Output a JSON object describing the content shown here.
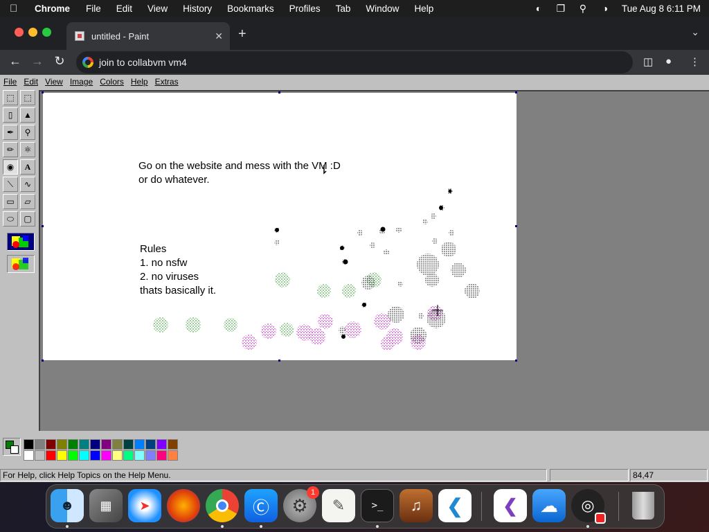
{
  "menubar": {
    "app": "Chrome",
    "items": [
      "File",
      "Edit",
      "View",
      "History",
      "Bookmarks",
      "Profiles",
      "Tab",
      "Window",
      "Help"
    ],
    "clock": "Tue Aug 8  6:11 PM"
  },
  "browser": {
    "tab_title": "untitled - Paint",
    "address": "join to collabvm vm4"
  },
  "paint": {
    "menu": [
      "File",
      "Edit",
      "View",
      "Image",
      "Colors",
      "Help",
      "Extras"
    ],
    "canvas_text": {
      "line1": "Go on the website and mess with the VM :D",
      "line2": "or do whatever.",
      "rules_title": "Rules",
      "rule1": "1. no nsfw",
      "rule2": "2. no viruses",
      "rule3": "thats basically it."
    },
    "status": {
      "help": "For Help, click Help Topics on the Help Menu.",
      "coords": "84,47"
    },
    "colors": {
      "foreground": "#008000",
      "background": "#ffffff",
      "palette_top": [
        "#000000",
        "#808080",
        "#800000",
        "#808000",
        "#008000",
        "#008080",
        "#000080",
        "#800080",
        "#808040",
        "#004040",
        "#0080ff",
        "#004080",
        "#8000ff",
        "#804000"
      ],
      "palette_bottom": [
        "#ffffff",
        "#c0c0c0",
        "#ff0000",
        "#ffff00",
        "#00ff00",
        "#00ffff",
        "#0000ff",
        "#ff00ff",
        "#ffff80",
        "#00ff80",
        "#80ffff",
        "#8080ff",
        "#ff0080",
        "#ff8040"
      ]
    }
  },
  "dock": {
    "badge_settings": "1"
  }
}
